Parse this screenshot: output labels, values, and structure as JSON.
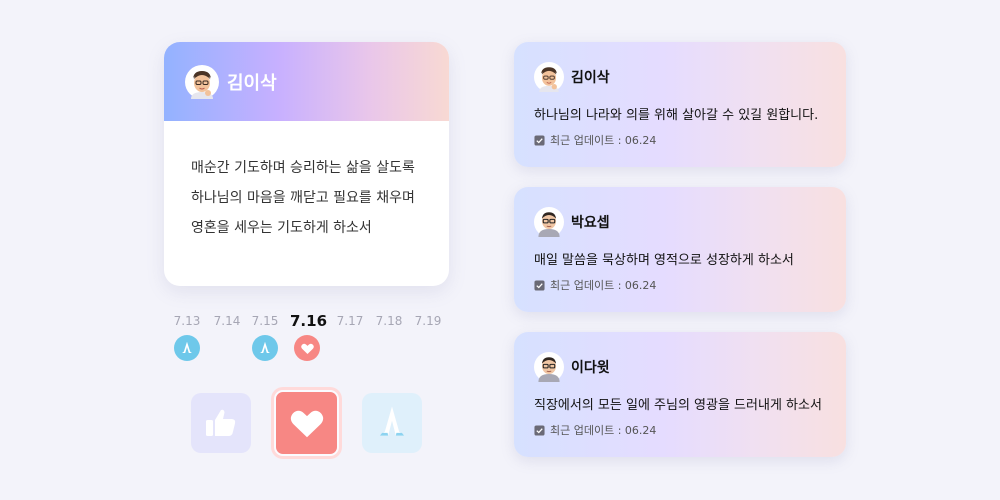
{
  "featured": {
    "name": "김이삭",
    "avatar_icon": "memoji-boy-icon",
    "prayer_lines": [
      "매순간 기도하며 승리하는 삶을 살도록",
      "하나님의 마음을 깨닫고 필요를 채우며",
      "영혼을 세우는 기도하게 하소서"
    ]
  },
  "date_strip": {
    "active": "7.16",
    "days": [
      {
        "label": "7.13",
        "mark": "pray-hands-icon"
      },
      {
        "label": "7.14",
        "mark": ""
      },
      {
        "label": "7.15",
        "mark": "pray-hands-icon"
      },
      {
        "label": "7.16",
        "mark": "heart-icon"
      },
      {
        "label": "7.17",
        "mark": ""
      },
      {
        "label": "7.18",
        "mark": ""
      },
      {
        "label": "7.19",
        "mark": ""
      }
    ]
  },
  "reactions": [
    {
      "icon": "thumbs-up-icon",
      "selected": false
    },
    {
      "icon": "heart-icon",
      "selected": true
    },
    {
      "icon": "pray-hands-icon",
      "selected": false
    }
  ],
  "prayer_list": [
    {
      "name": "김이삭",
      "prayer": "하나님의 나라와 의를 위해 살아갈 수 있길 원합니다.",
      "updated": "최근 업데이트 : 06.24",
      "avatar_icon": "memoji-boy-icon"
    },
    {
      "name": "박요셉",
      "prayer": "매일 말씀을 묵상하며 영적으로 성장하게 하소서",
      "updated": "최근 업데이트 : 06.24",
      "avatar_icon": "memoji-glasses-icon"
    },
    {
      "name": "이다윗",
      "prayer": "직장에서의 모든 일에 주님의 영광을 드러내게 하소서",
      "updated": "최근 업데이트 : 06.24",
      "avatar_icon": "memoji-glasses-icon"
    }
  ],
  "colors": {
    "accent_heart": "#f78784",
    "accent_pray": "#6ec8ea",
    "like_bg": "#e4e4fb"
  }
}
